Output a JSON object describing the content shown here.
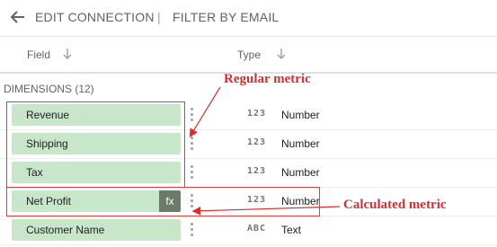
{
  "topbar": {
    "edit_connection": "EDIT CONNECTION",
    "separator": "|",
    "filter_by_email": "FILTER BY EMAIL"
  },
  "columns": {
    "field": "Field",
    "type": "Type"
  },
  "section_label": "DIMENSIONS (12)",
  "rows": [
    {
      "name": "Revenue",
      "type_icon": "123",
      "type": "Number",
      "calculated": false
    },
    {
      "name": "Shipping",
      "type_icon": "123",
      "type": "Number",
      "calculated": false
    },
    {
      "name": "Tax",
      "type_icon": "123",
      "type": "Number",
      "calculated": false
    },
    {
      "name": "Net Profit",
      "type_icon": "123",
      "type": "Number",
      "calculated": true,
      "badge": "fx"
    },
    {
      "name": "Customer Name",
      "type_icon": "ABC",
      "type": "Text",
      "calculated": false
    }
  ],
  "annotations": {
    "regular": "Regular metric",
    "calculated": "Calculated metric",
    "color": "#d32f2f"
  },
  "colors": {
    "chip": "#c8e6c9",
    "fx_badge": "#6b7a6b"
  }
}
